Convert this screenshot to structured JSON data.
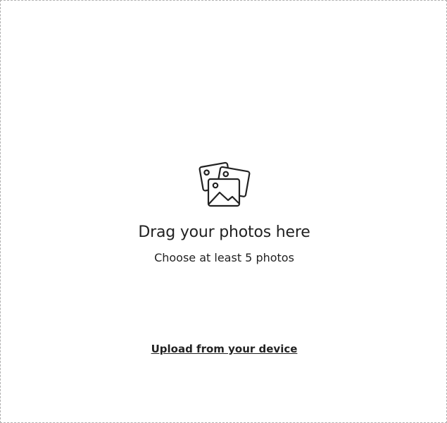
{
  "dropzone": {
    "title": "Drag your photos here",
    "subtitle": "Choose at least 5 photos",
    "upload_link": "Upload from your device",
    "icon": "photos-stack-icon"
  }
}
